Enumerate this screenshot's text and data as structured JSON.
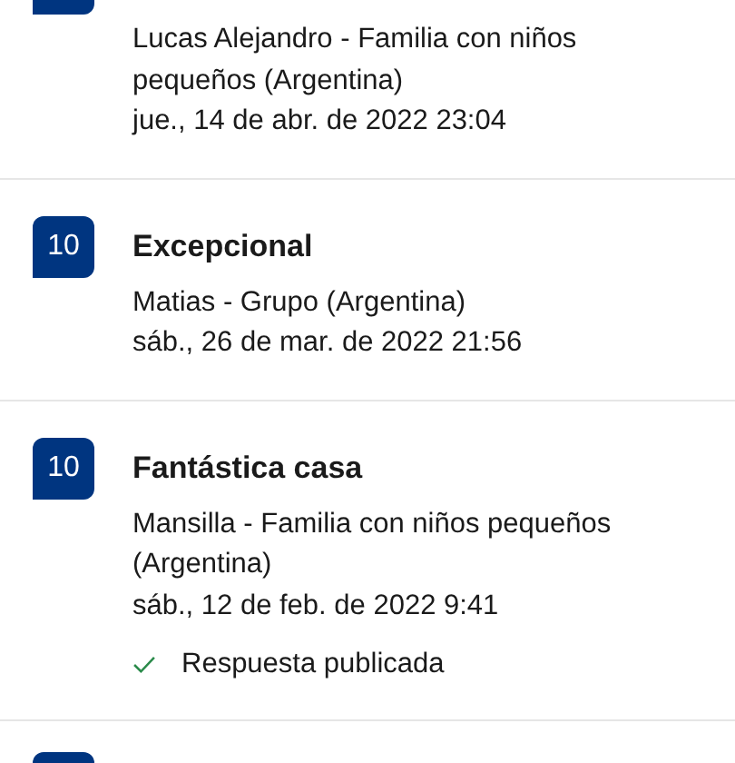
{
  "reviews": [
    {
      "kind": "cut_top",
      "author": "Lucas Alejandro - Familia con niños pequeños (Argentina)",
      "date": "jue., 14 de abr. de 2022 23:04"
    },
    {
      "kind": "full",
      "score": "10",
      "title": "Excepcional",
      "author": "Matias - Grupo (Argentina)",
      "date": "sáb., 26 de mar. de 2022 21:56"
    },
    {
      "kind": "full",
      "score": "10",
      "title": "Fantástica casa",
      "author": "Mansilla - Familia con niños pequeños (Argentina)",
      "date": "sáb., 12 de feb. de 2022 9:41",
      "response": "Respuesta publicada"
    },
    {
      "kind": "cut_bottom"
    }
  ]
}
